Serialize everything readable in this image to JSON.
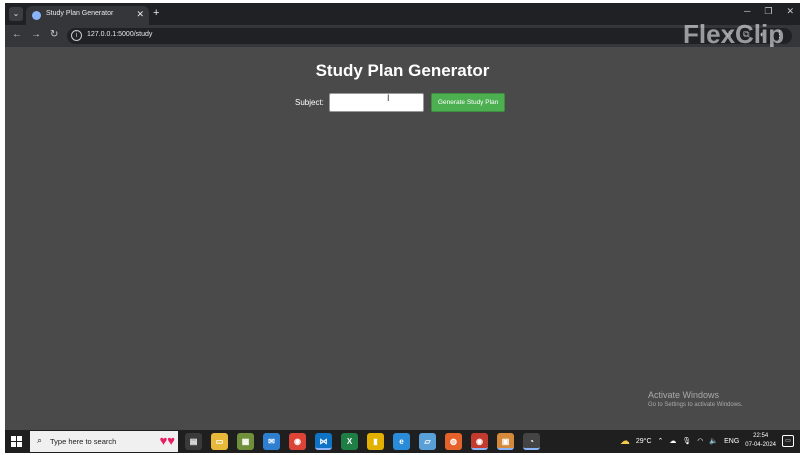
{
  "browser": {
    "tab_title": "Study Plan Generator",
    "tab_close": "✕",
    "new_tab": "+",
    "url": "127.0.0.1:5000/study",
    "window_minimize": "─",
    "window_restore": "❐",
    "window_close": "✕"
  },
  "watermark": "FlexClip",
  "page": {
    "title": "Study Plan Generator",
    "subject_label": "Subject:",
    "subject_value": "",
    "generate_button": "Generate Study Plan"
  },
  "activation": {
    "title": "Activate Windows",
    "subtitle": "Go to Settings to activate Windows."
  },
  "taskbar": {
    "search_placeholder": "Type here to search",
    "weather": "29°C",
    "language": "ENG",
    "time": "22:54",
    "date": "07-04-2024"
  },
  "colors": {
    "accent_button": "#4caf50",
    "page_background": "#4a4a4a"
  }
}
